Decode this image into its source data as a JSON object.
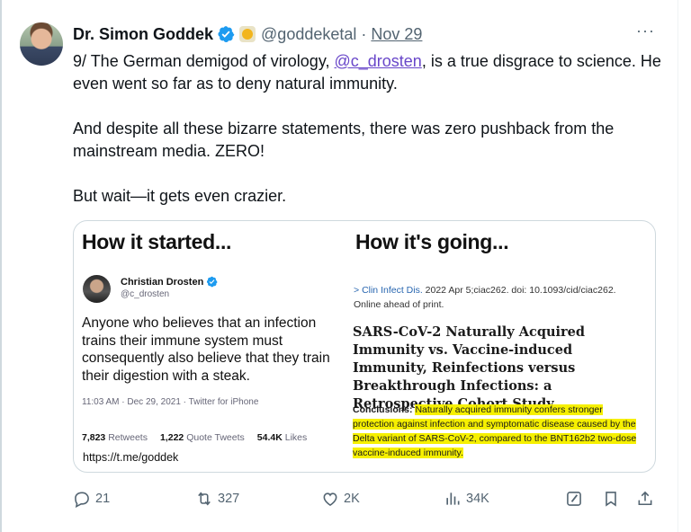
{
  "tweet": {
    "name": "Dr. Simon Goddek",
    "handle": "@goddeketal",
    "separator": "·",
    "date": "Nov 29",
    "more_label": "···",
    "lines": [
      {
        "before": "9/ The German demigod of virology, ",
        "mention": "@c_drosten",
        "after": ", is a true disgrace to science. He even went so far as to deny natural immunity."
      },
      {
        "text": "And despite all these bizarre statements, there was zero pushback from the mainstream media. ZERO!"
      },
      {
        "text": "But wait—it gets even crazier."
      }
    ]
  },
  "media": {
    "left_heading": "How it started...",
    "right_heading": "How it's going...",
    "embedded_tweet": {
      "name": "Christian Drosten",
      "handle": "@c_drosten",
      "text": "Anyone who believes that an infection trains their immune system must consequently also believe that they train their digestion with a steak.",
      "meta": "11:03 AM · Dec 29, 2021 · Twitter for iPhone",
      "retweets_count": "7,823",
      "retweets_label": "Retweets",
      "quotes_count": "1,222",
      "quotes_label": "Quote Tweets",
      "likes_count": "54.4K",
      "likes_label": "Likes",
      "link": "https://t.me/goddek"
    },
    "paper": {
      "arrow": ">",
      "journal": "Clin Infect Dis.",
      "citation": " 2022 Apr 5;ciac262. doi: 10.1093/cid/ciac262.",
      "status": "Online ahead of print.",
      "title": "SARS-CoV-2 Naturally Acquired Immunity vs. Vaccine-induced Immunity, Reinfections versus Breakthrough Infections: a Retrospective Cohort Study",
      "conclusions_label": "Conclusions:",
      "conclusions_text": "Naturally acquired immunity confers stronger protection against infection and symptomatic disease caused by the Delta variant of SARS-CoV-2, compared to the BNT162b2 two-dose vaccine-induced immunity."
    }
  },
  "actions": {
    "replies": "21",
    "reposts": "327",
    "likes": "2K",
    "views": "34K"
  },
  "colors": {
    "mention": "#6846c9",
    "verified": "#1d9bf0",
    "highlight": "#f6f000",
    "muted": "#536471"
  }
}
